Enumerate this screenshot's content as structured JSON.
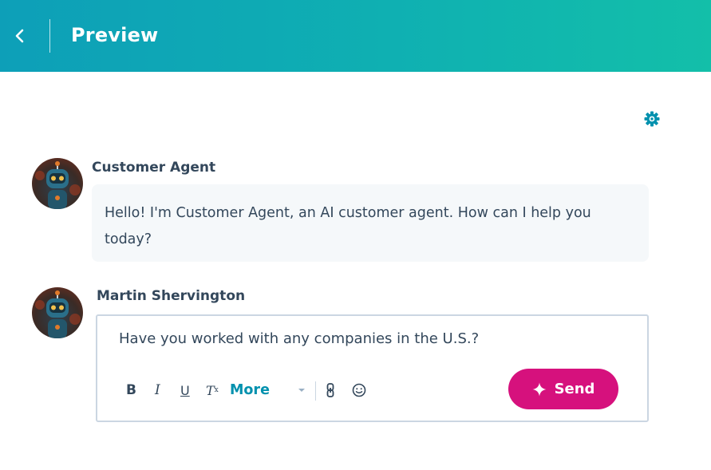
{
  "header": {
    "title": "Preview",
    "gradient": [
      "#0d9fb8",
      "#13bfa9"
    ]
  },
  "icons": {
    "back": "chevron-left-icon",
    "settings": "gear-icon",
    "link": "link-icon",
    "emoji": "emoji-icon",
    "send": "sparkle-icon"
  },
  "messages": [
    {
      "sender": "Customer Agent",
      "text": "Hello! I'm Customer Agent, an AI customer agent. How can I help you today?"
    }
  ],
  "composer": {
    "sender": "Martin Shervington",
    "value": "Have you worked with any companies in the U.S.?",
    "toolbar": {
      "bold": "B",
      "italic": "I",
      "underline": "U",
      "clear_format": "T",
      "clear_format_sub": "x",
      "more": "More"
    },
    "send_label": "Send"
  },
  "colors": {
    "accent": "#0091ae",
    "send": "#d6117d",
    "text": "#33475b"
  }
}
